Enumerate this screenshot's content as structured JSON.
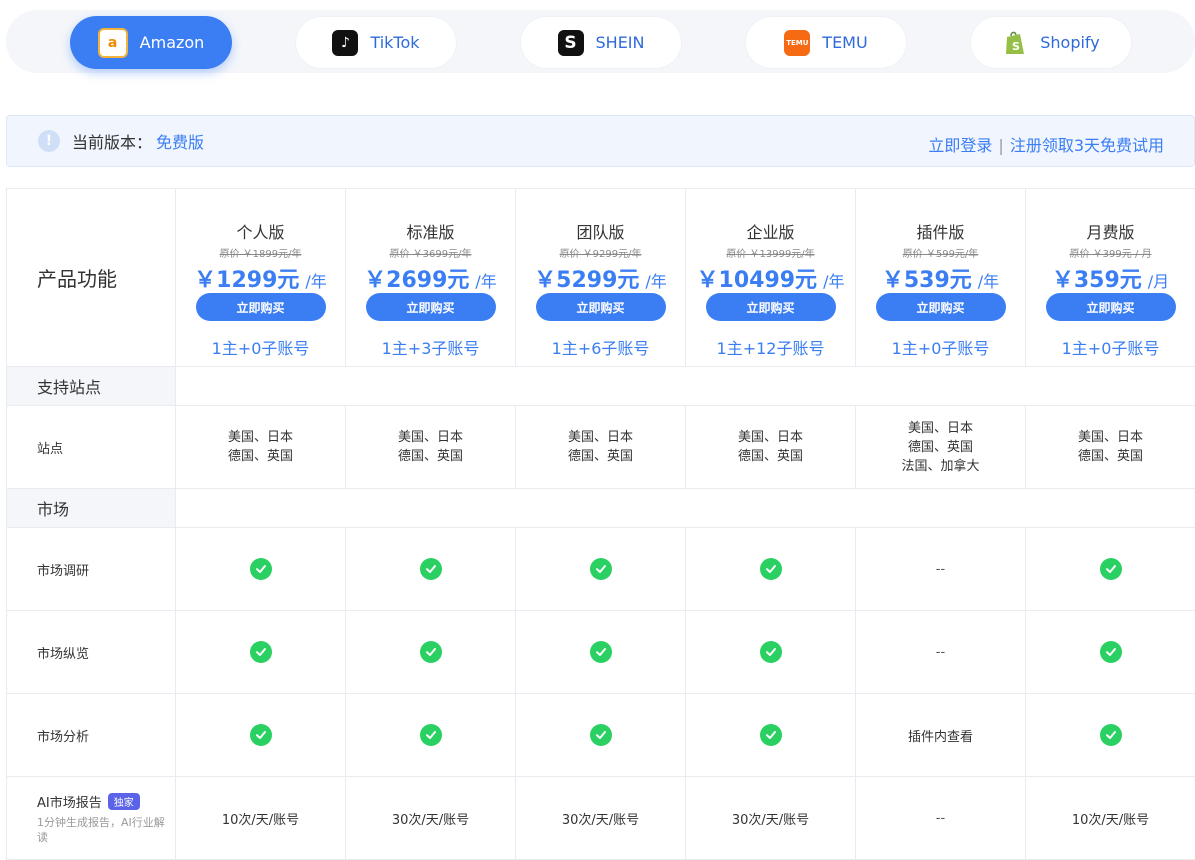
{
  "platform_tabs": [
    {
      "label": "Amazon",
      "icon": "amazon-logo",
      "active": true
    },
    {
      "label": "TikTok",
      "icon": "tiktok-logo",
      "active": false
    },
    {
      "label": "SHEIN",
      "icon": "shein-logo",
      "active": false
    },
    {
      "label": "TEMU",
      "icon": "temu-logo",
      "active": false
    },
    {
      "label": "Shopify",
      "icon": "shopify-logo",
      "active": false
    }
  ],
  "version": {
    "label": "当前版本：",
    "value": "免费版",
    "login_link": "立即登录",
    "separator": "|",
    "trial_link": "注册领取3天免费试用"
  },
  "table": {
    "header_label": "产品功能",
    "plans": [
      {
        "name": "个人版",
        "original": "原价 ￥1899元/年",
        "price": "￥1299元",
        "unit": "/年",
        "button": "立即购买",
        "accounts": "1主+0子账号"
      },
      {
        "name": "标准版",
        "original": "原价 ￥3699元/年",
        "price": "￥2699元",
        "unit": "/年",
        "button": "立即购买",
        "accounts": "1主+3子账号"
      },
      {
        "name": "团队版",
        "original": "原价 ￥9299元/年",
        "price": "￥5299元",
        "unit": "/年",
        "button": "立即购买",
        "accounts": "1主+6子账号"
      },
      {
        "name": "企业版",
        "original": "原价 ￥13999元/年",
        "price": "￥10499元",
        "unit": "/年",
        "button": "立即购买",
        "accounts": "1主+12子账号"
      },
      {
        "name": "插件版",
        "original": "原价 ￥599元/年",
        "price": "￥539元",
        "unit": "/年",
        "button": "立即购买",
        "accounts": "1主+0子账号"
      },
      {
        "name": "月费版",
        "original": "原价 ￥399元 / 月",
        "price": "￥359元",
        "unit": "/月",
        "button": "立即购买",
        "accounts": "1主+0子账号"
      }
    ],
    "sections": {
      "sites": "支持站点",
      "market": "市场"
    },
    "rows": {
      "site": {
        "label": "站点",
        "values": [
          [
            "美国、日本",
            "德国、英国"
          ],
          [
            "美国、日本",
            "德国、英国"
          ],
          [
            "美国、日本",
            "德国、英国"
          ],
          [
            "美国、日本",
            "德国、英国"
          ],
          [
            "美国、日本",
            "德国、英国",
            "法国、加拿大"
          ],
          [
            "美国、日本",
            "德国、英国"
          ]
        ]
      },
      "market_research": {
        "label": "市场调研",
        "values": [
          "check",
          "check",
          "check",
          "check",
          "--",
          "check"
        ]
      },
      "market_overview": {
        "label": "市场纵览",
        "values": [
          "check",
          "check",
          "check",
          "check",
          "--",
          "check"
        ]
      },
      "market_analysis": {
        "label": "市场分析",
        "values": [
          "check",
          "check",
          "check",
          "check",
          "插件内查看",
          "check"
        ]
      },
      "ai_report": {
        "label": "AI市场报告",
        "badge": "独家",
        "desc": "1分钟生成报告，AI行业解读",
        "values": [
          "10次/天/账号",
          "30次/天/账号",
          "30次/天/账号",
          "30次/天/账号",
          "--",
          "10次/天/账号"
        ]
      }
    }
  },
  "colors": {
    "primary": "#3b7ef4",
    "check": "#2bd063",
    "badge": "#5b63e8"
  }
}
